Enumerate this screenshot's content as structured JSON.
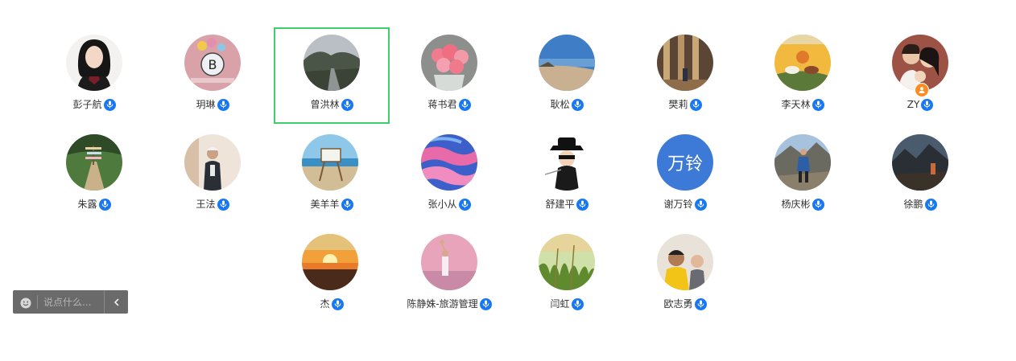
{
  "participants": [
    {
      "name": "彭子航"
    },
    {
      "name": "玥琳"
    },
    {
      "name": "曾洪林",
      "active": true
    },
    {
      "name": "蒋书君"
    },
    {
      "name": "耿松"
    },
    {
      "name": "樊莉"
    },
    {
      "name": "李天林"
    },
    {
      "name": "ZY",
      "badge": "host-person-icon"
    },
    {
      "name": "朱露"
    },
    {
      "name": "王法"
    },
    {
      "name": "美羊羊"
    },
    {
      "name": "张小从"
    },
    {
      "name": "舒建平"
    },
    {
      "name": "谢万铃",
      "avatar_text": "万铃",
      "avatar_color": "#3d7ad8"
    },
    {
      "name": "杨庆彬"
    },
    {
      "name": "徐鹏"
    },
    {
      "name": "杰"
    },
    {
      "name": "陈静姝-旅游管理"
    },
    {
      "name": "闫虹"
    },
    {
      "name": "欧志勇"
    }
  ],
  "chat": {
    "placeholder": "说点什么...",
    "emoji_icon": "smiley-icon",
    "collapse_icon": "chevron-left-icon"
  },
  "colors": {
    "active_border": "#3ecf6a",
    "mic_badge": "#1877f2",
    "chat_bar": "#6a6a6a"
  }
}
